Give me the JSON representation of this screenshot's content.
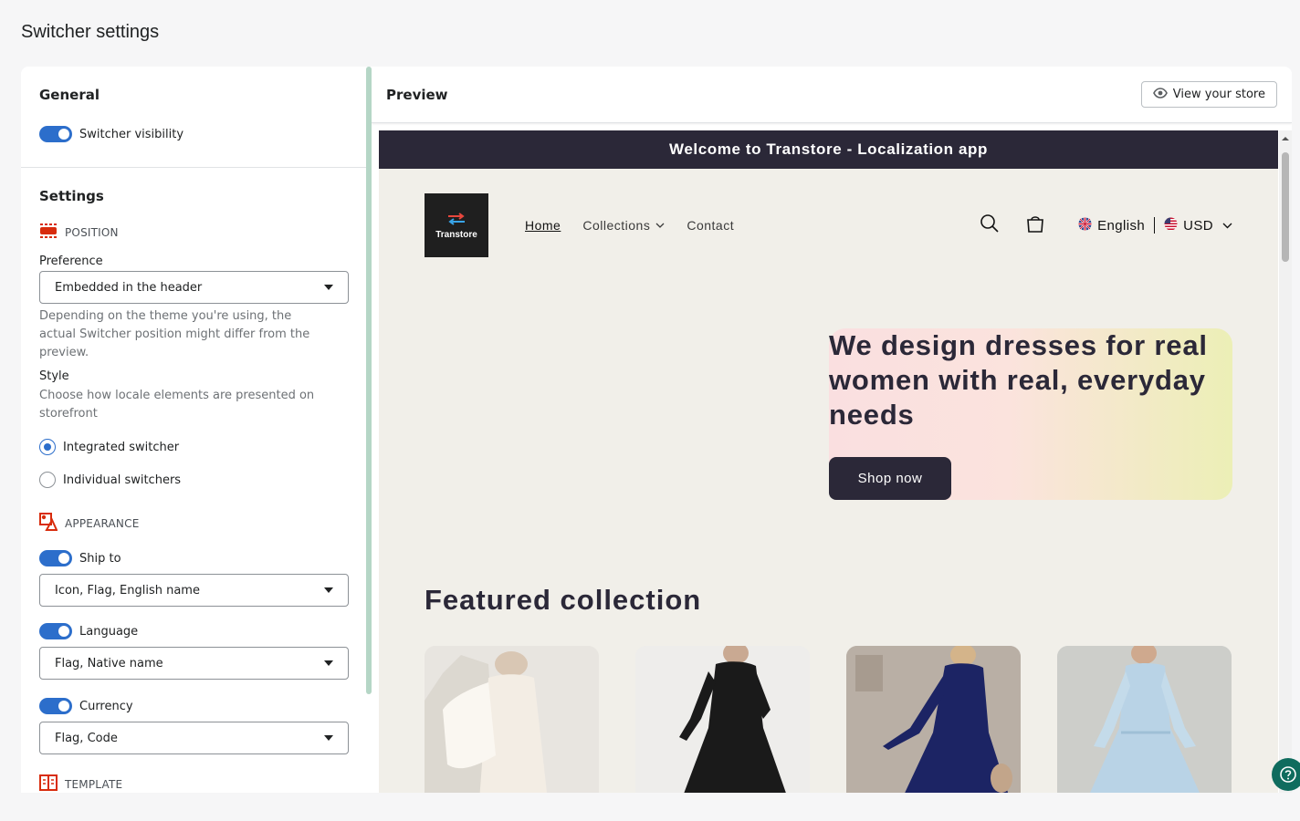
{
  "page": {
    "title": "Switcher settings"
  },
  "general": {
    "title": "General",
    "switcher_visibility_label": "Switcher visibility",
    "switcher_visibility_on": true
  },
  "settings": {
    "title": "Settings",
    "position": {
      "heading": "POSITION",
      "preference_label": "Preference",
      "preference_value": "Embedded in the header",
      "help_text": "Depending on the theme you're using, the actual Switcher position might differ from the preview.",
      "style_label": "Style",
      "style_help": "Choose how locale elements are presented on storefront",
      "style_options": [
        {
          "label": "Integrated switcher",
          "selected": true
        },
        {
          "label": "Individual switchers",
          "selected": false
        }
      ]
    },
    "appearance": {
      "heading": "APPEARANCE",
      "ship_to_label": "Ship to",
      "ship_to_value": "Icon, Flag, English name",
      "language_label": "Language",
      "language_value": "Flag, Native name",
      "currency_label": "Currency",
      "currency_value": "Flag, Code"
    },
    "template": {
      "heading": "TEMPLATE"
    }
  },
  "preview": {
    "title": "Preview",
    "view_store_label": "View your store"
  },
  "store": {
    "announcement": "Welcome to Transtore - Localization app",
    "logo_text": "Transtore",
    "nav": [
      "Home",
      "Collections",
      "Contact"
    ],
    "language": "English",
    "currency": "USD",
    "hero_text": "We design dresses for real women with real, everyday needs",
    "hero_button": "Shop now",
    "featured_title": "Featured collection"
  },
  "colors": {
    "accent": "#2c6ecb",
    "announcement_bg": "#2b2838",
    "store_bg": "#f1efe9",
    "icon_red": "#d82c0d"
  }
}
